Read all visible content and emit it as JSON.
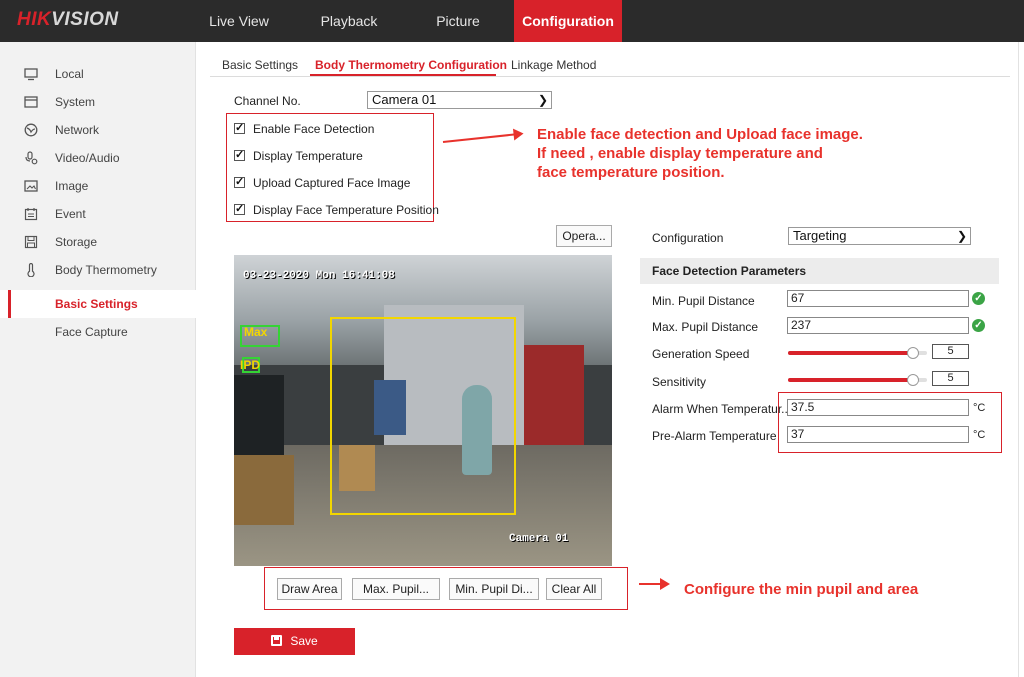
{
  "brand": {
    "part1": "HIK",
    "part2": "VISION"
  },
  "nav": [
    {
      "label": "Live View",
      "active": false
    },
    {
      "label": "Playback",
      "active": false
    },
    {
      "label": "Picture",
      "active": false
    },
    {
      "label": "Configuration",
      "active": true
    }
  ],
  "sidebar": {
    "items": [
      {
        "label": "Local",
        "icon": "monitor-icon"
      },
      {
        "label": "System",
        "icon": "system-icon"
      },
      {
        "label": "Network",
        "icon": "network-icon"
      },
      {
        "label": "Video/Audio",
        "icon": "video-audio-icon"
      },
      {
        "label": "Image",
        "icon": "image-icon"
      },
      {
        "label": "Event",
        "icon": "event-icon"
      },
      {
        "label": "Storage",
        "icon": "storage-icon"
      },
      {
        "label": "Body Thermometry",
        "icon": "thermometer-icon"
      },
      {
        "label": "Basic Settings",
        "selected": true
      },
      {
        "label": "Face Capture"
      }
    ]
  },
  "tabs": [
    {
      "label": "Basic Settings",
      "active": false
    },
    {
      "label": "Body Thermometry Configuration",
      "active": true
    },
    {
      "label": "Linkage Method",
      "active": false
    }
  ],
  "channel": {
    "label": "Channel No.",
    "value": "Camera 01"
  },
  "checkboxes": [
    {
      "label": "Enable Face Detection",
      "checked": true
    },
    {
      "label": "Display Temperature",
      "checked": true
    },
    {
      "label": "Upload Captured Face Image",
      "checked": true
    },
    {
      "label": "Display Face Temperature Position",
      "checked": true
    }
  ],
  "annotations": {
    "top_line1": "Enable face detection and Upload face image.",
    "top_line2": "If need , enable display temperature and",
    "top_line3": "face temperature position.",
    "bottom": "Configure the min pupil and area"
  },
  "opera_button": "Opera...",
  "video": {
    "timestamp": "03-23-2020 Mon 16:41:08",
    "camera_label": "Camera 01",
    "max_label": "Max",
    "min_label": "IPD"
  },
  "draw_buttons": [
    "Draw Area",
    "Max. Pupil...",
    "Min. Pupil Di...",
    "Clear All"
  ],
  "configuration": {
    "label": "Configuration",
    "value": "Targeting"
  },
  "params": {
    "header": "Face Detection Parameters",
    "min_pupil": {
      "label": "Min. Pupil Distance",
      "value": "67"
    },
    "max_pupil": {
      "label": "Max. Pupil Distance",
      "value": "237"
    },
    "generation_speed": {
      "label": "Generation Speed",
      "value": "5",
      "fraction": 0.9
    },
    "sensitivity": {
      "label": "Sensitivity",
      "value": "5",
      "fraction": 0.9
    },
    "alarm_temp": {
      "label": "Alarm When Temperatur...",
      "value": "37.5",
      "unit": "°C"
    },
    "pre_alarm_temp": {
      "label": "Pre-Alarm Temperature",
      "value": "37",
      "unit": "°C"
    }
  },
  "save_label": "Save",
  "colors": {
    "accent": "#d8222a",
    "annotation": "#e8322c",
    "ok": "#3ba446",
    "topbar": "#2b2b2b"
  }
}
